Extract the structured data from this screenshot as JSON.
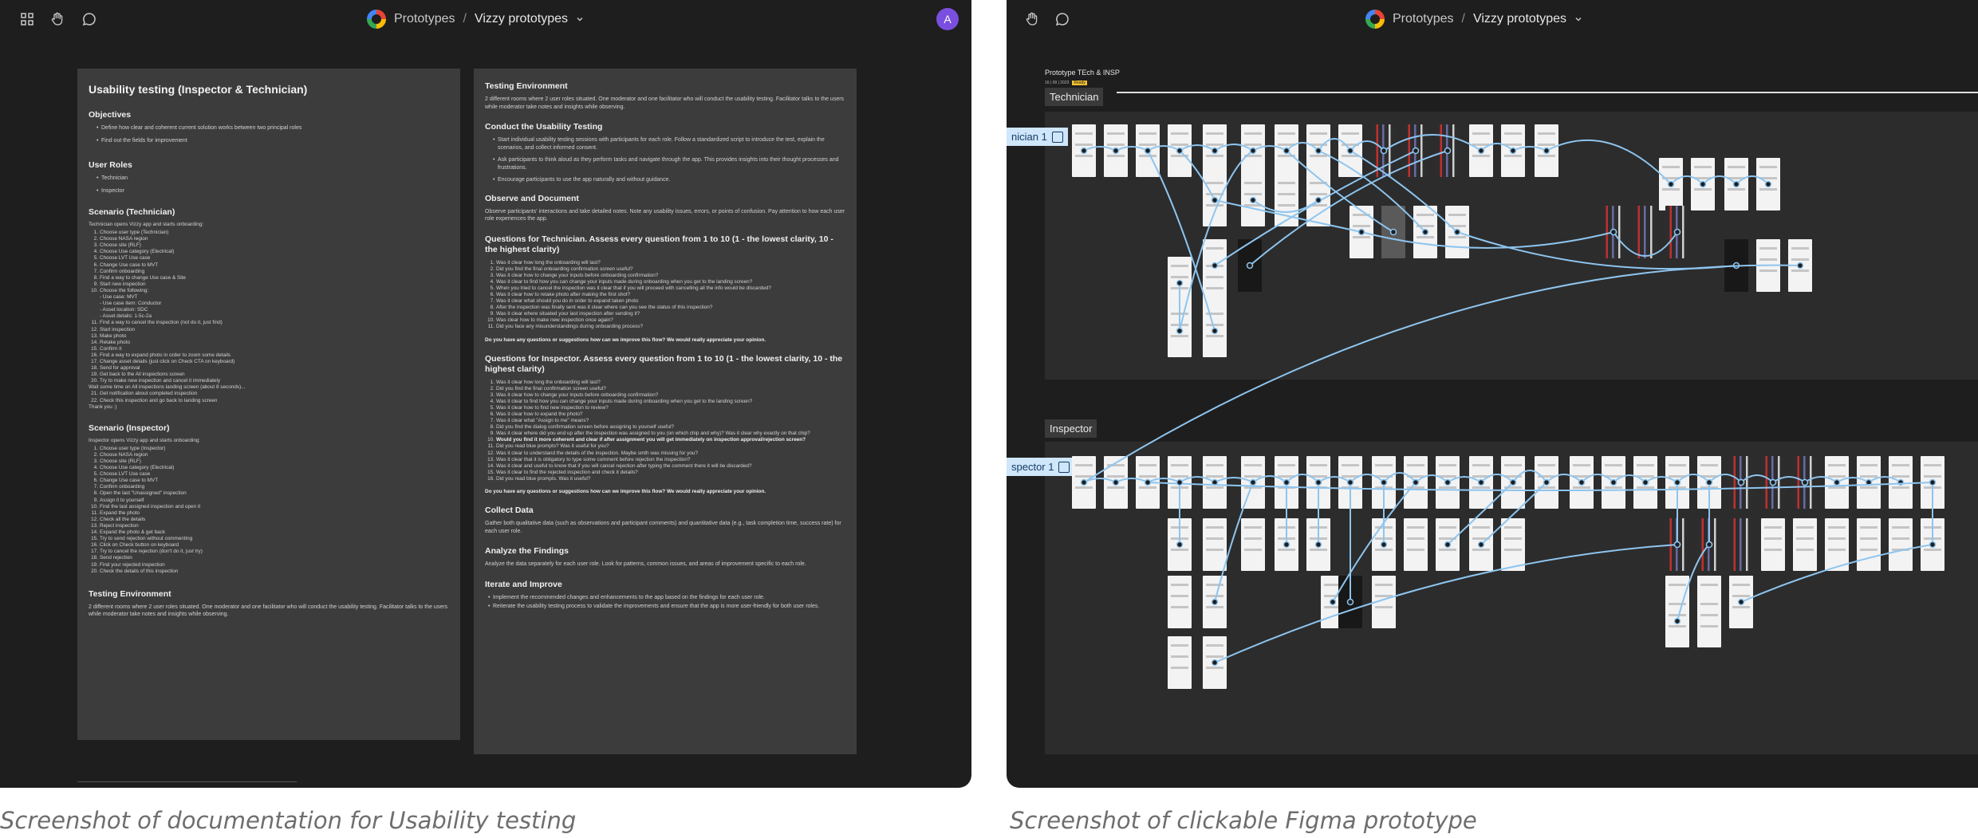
{
  "left": {
    "breadcrumb": {
      "project": "Prototypes",
      "separator": "/",
      "file": "Vizzy prototypes",
      "chevron": "chevron-down-icon"
    },
    "avatar_initial": "A",
    "doc_left": {
      "title": "Usability testing (Inspector & Technician)",
      "objectives_heading": "Objectives",
      "objectives": [
        "Define how clear and coherent current solution works between two principal roles",
        "Find out the fields for improvement"
      ],
      "roles_heading": "User Roles",
      "roles": [
        "Technician",
        "Inspector"
      ],
      "scenario_tech_heading": "Scenario (Technician)",
      "scenario_tech_intro": "Technician opens Vizzy app and starts onboarding:",
      "scenario_tech_steps": [
        "Choose user type (Technician)",
        "Choose NASA region",
        "Choose site (RLF)",
        "Choose Use category (Electrical)",
        "Choose LVT Use case",
        "Change Use case to MVT",
        "Confirm onboarding",
        "Find a way to change Use case & Site",
        "Start new inspection",
        "Choose the following:"
      ],
      "scenario_tech_sub": [
        "- Use case: MVT",
        "- Use case item: Conductor",
        "- Asset location: SDC",
        "- Asset details: 1-5c-2a"
      ],
      "scenario_tech_steps2": [
        "Find a way to cancel the inspection (not do it, just find)",
        "Start inspection",
        "Make photo",
        "Retake photo",
        "Confirm it",
        "Find a way to expand photo in order to zoom some details",
        "Change asset details (just click on Check CTA on keyboard)",
        "Send for approval",
        "Get back to the All inspections screen",
        "Try to make new inspection and cancel it immediately"
      ],
      "scenario_tech_wait": "Wait some time on All inspections landing screen (about 8 seconds)...",
      "scenario_tech_steps3": [
        "Get notification about completed inspection",
        "Check this inspection and go back to landing screen"
      ],
      "scenario_tech_thanks": "Thank you :)",
      "scenario_insp_heading": "Scenario (Inspector)",
      "scenario_insp_intro": "Inspector opens Vizzy app and starts onboarding:",
      "scenario_insp_steps": [
        "Choose user type (Inspector)",
        "Choose NASA region",
        "Choose site (RLF)",
        "Choose Use category (Electrical)",
        "Choose LVT Use case",
        "Change Use case to MVT",
        "Confirm onboarding",
        "Open the last \"Unassigned\" inspection",
        "Assign it to yourself",
        "Find the last assigned inspection and open it",
        "Expand the photo",
        "Check all the details",
        "Reject inspection",
        "Expand the photo & get back",
        "Try to send rejection without commenting",
        "Click on Check button on keyboard",
        "Try to cancel the rejection (don't do it, just try)",
        "Send rejection",
        "Find your rejected inspection",
        "Check the details of this inspection"
      ],
      "env_heading": "Testing Environment",
      "env_text": "2 different rooms where 2 user roles situated. One moderator and one facilitator who will conduct the usability testing. Facilitator talks to the users while moderator take notes and insights while observing."
    },
    "doc_right": {
      "env_heading": "Testing Environment",
      "env_text": "2 different rooms where 2 user roles situated. One moderator and one facilitator who will conduct the usability testing. Facilitator talks to the users while moderator take notes and insights while observing.",
      "conduct_heading": "Conduct the Usability Testing",
      "conduct_items": [
        "Start individual usability testing sessions with participants for each role. Follow a standardized script to introduce the test, explain the scenarios, and collect informed consent.",
        "Ask participants to think aloud as they perform tasks and navigate through the app. This provides insights into their thought processes and frustrations.",
        "Encourage participants to use the app naturally and without guidance."
      ],
      "observe_heading": "Observe and Document",
      "observe_text": "Observe participants' interactions and take detailed notes. Note any usability issues, errors, or points of confusion. Pay attention to how each user role experiences the app.",
      "q_tech_heading": "Questions for Technician. Assess every question from 1 to 10 (1 - the lowest clarity, 10 - the highest clarity)",
      "q_tech": [
        "Was it clear how long the onboarding will last?",
        "Did you find the final onboarding confirmation screen useful?",
        "Was it clear how to change your inputs before onboarding confirmation?",
        "Was it clear to find how you can change your inputs made during onboarding when you get to the landing screen?",
        "When you tried to cancel the inspection was it clear that if you will proceed with cancelling all the info would be discarded?",
        "Was it clear how to retake photo after making the first shot?",
        "Was it clear what should you do in order to expand taken photo",
        "After the inspection was finally sent was it clear where can you see the status of this inspection?",
        "Was it clear where situated your last inspection after sending it?",
        "Was clear how to make new inspection once again?",
        "Did you face any misunderstandings during onboarding process?"
      ],
      "q_tech_ask": "Do you have any questions or suggestions how can we improve this flow? We would really appreciate your opinion.",
      "q_insp_heading": "Questions for Inspector. Assess every question from 1 to 10 (1 - the lowest clarity, 10 - the highest clarity)",
      "q_insp": [
        "Was it clear how long the onboarding will last?",
        "Did you find the final confirmation screen useful?",
        "Was it clear how to change your inputs before onboarding confirmation?",
        "Was it clear to find how you can change your inputs made during onboarding when you get to the landing screen?",
        "Was it clear how to find new inspection to review?",
        "Was it clear how to expand the photo?",
        "Was it clear what \"Assign to me\" means?",
        "Did you find the dialog confirmation screen before assigning to yourself useful?",
        "Was it clear where did you end up after the Inspection was assigned to you (on which chip and why)? Was it clear why exactly on that chip?",
        "Would you find it more coherent and clear if after assignment you will get immediately on inspection approval/rejection screen?",
        "Did you read blue prompts? Was it useful for you?",
        "Was it clear to understand the details of the inspection. Maybe smth was missing for you?",
        "Was it clear that it is obligatory to type some comment before rejection the inspection?",
        "Was it clear and useful to know that if you will cancel rejection after typing the comment there it will be discarded?",
        "Was it clear to find the rejected inspection and check it details?",
        "Did you read blue prompts. Was it useful?"
      ],
      "q_insp_ask": "Do you have any questions or suggestions how can we improve this flow? We would really appreciate your opinion.",
      "collect_heading": "Collect Data",
      "collect_text": "Gather both qualitative data (such as observations and participant comments) and quantitative data (e.g., task completion time, success rate) for each user role.",
      "analyze_heading": "Analyze the Findings",
      "analyze_text": "Analyze the data separately for each user role. Look for patterns, common issues, and areas of improvement specific to each role.",
      "iterate_heading": "Iterate and Improve",
      "iterate_items": [
        "Implement the recommended changes and enhancements to the app based on the findings for each user role.",
        "Reiterate the usability testing process to validate the improvements and ensure that the app is more user-friendly for both user roles."
      ]
    },
    "caption": "Screenshot of documentation for Usability testing"
  },
  "right": {
    "breadcrumb": {
      "project": "Prototypes",
      "separator": "/",
      "file": "Vizzy prototypes",
      "chevron": "chevron-down-icon"
    },
    "proto_title": "Prototype TEch & INSP",
    "proto_date": "16 | 09 | 2023",
    "proto_badge": "Ready",
    "technician_label": "Technician",
    "technician_flow": "nician 1",
    "inspector_label": "Inspector",
    "inspector_flow": "spector 1",
    "caption": "Screenshot of clickable Figma prototype",
    "colors": {
      "wire": "#8ec5ef",
      "flow_tag": "#cfe6fb",
      "canvas": "#1e1e1e",
      "section": "#2c2c2c"
    }
  }
}
